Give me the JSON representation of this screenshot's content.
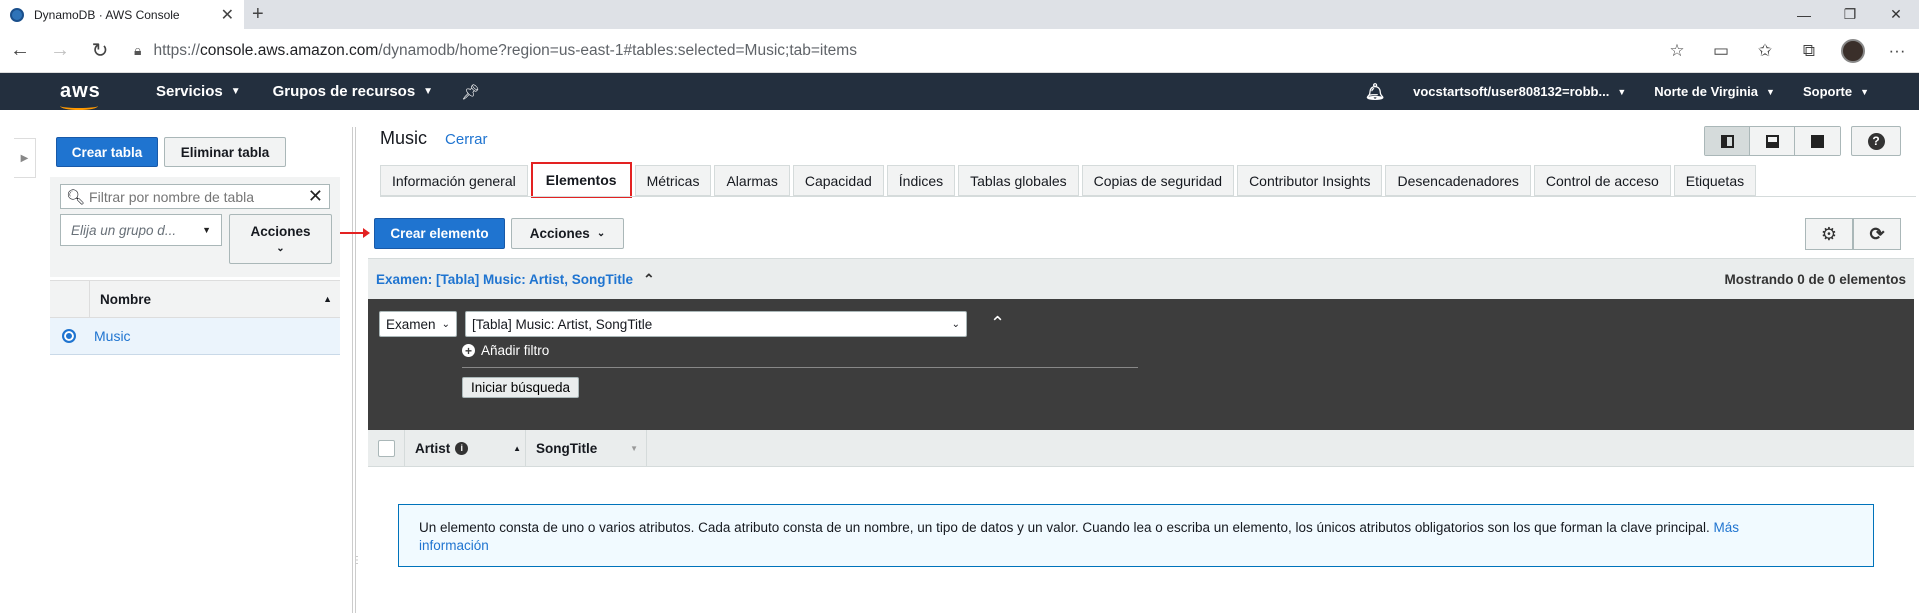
{
  "browser": {
    "tab_title": "DynamoDB · AWS Console",
    "url_prefix": "https://",
    "url_host": "console.aws.amazon.com",
    "url_path": "/dynamodb/home?region=us-east-1#tables:selected=Music;tab=items"
  },
  "aws_header": {
    "logo": "aws",
    "services": "Servicios",
    "resource_groups": "Grupos de recursos",
    "account": "vocstartsoft/user808132=robb...",
    "region": "Norte de Virginia",
    "support": "Soporte"
  },
  "left": {
    "create_table": "Crear tabla",
    "delete_table": "Eliminar tabla",
    "filter_placeholder": "Filtrar por nombre de tabla",
    "group_placeholder": "Elija un grupo d...",
    "actions": "Acciones",
    "col_name": "Nombre",
    "tables": [
      "Music"
    ]
  },
  "main": {
    "table_name": "Music",
    "close": "Cerrar",
    "tabs": [
      "Información general",
      "Elementos",
      "Métricas",
      "Alarmas",
      "Capacidad",
      "Índices",
      "Tablas globales",
      "Copias de seguridad",
      "Contributor Insights",
      "Desencadenadores",
      "Control de acceso",
      "Etiquetas"
    ],
    "selected_tab": "Elementos",
    "create_item": "Crear elemento",
    "actions": "Acciones",
    "scan_title": "Examen: [Tabla] Music: Artist, SongTitle",
    "showing": "Mostrando 0 de 0 elementos",
    "scan_type": "Examen",
    "scan_target": "[Tabla] Music: Artist, SongTitle",
    "add_filter": "Añadir filtro",
    "start_search": "Iniciar búsqueda",
    "columns": [
      "Artist",
      "SongTitle"
    ],
    "info_text": "Un elemento consta de uno o varios atributos. Cada atributo consta de un nombre, un tipo de datos y un valor. Cuando lea o escriba un elemento, los únicos atributos obligatorios son los que forman la clave principal.",
    "info_link_1": "Más",
    "info_link_2": "información"
  }
}
